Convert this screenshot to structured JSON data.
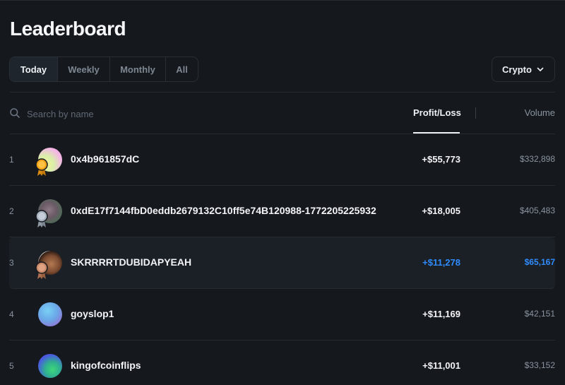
{
  "header": {
    "title": "Leaderboard"
  },
  "tabs": [
    {
      "label": "Today",
      "active": true
    },
    {
      "label": "Weekly",
      "active": false
    },
    {
      "label": "Monthly",
      "active": false
    },
    {
      "label": "All",
      "active": false
    }
  ],
  "category_select": {
    "value": "Crypto"
  },
  "search": {
    "placeholder": "Search by name",
    "value": ""
  },
  "columns": {
    "profit_loss": "Profit/Loss",
    "volume": "Volume"
  },
  "rows": [
    {
      "rank": "1",
      "name": "0x4b961857dC",
      "profit": "+$55,773",
      "volume": "$332,898",
      "medal": "gold"
    },
    {
      "rank": "2",
      "name": "0xdE17f7144fbD0eddb2679132C10ff5e74B120988-1772205225932",
      "profit": "+$18,005",
      "volume": "$405,483",
      "medal": "silver"
    },
    {
      "rank": "3",
      "name": "SKRRRRTDUBIDAPYEAH",
      "profit": "+$11,278",
      "volume": "$65,167",
      "medal": "bronze",
      "highlighted": true
    },
    {
      "rank": "4",
      "name": "goyslop1",
      "profit": "+$11,169",
      "volume": "$42,151"
    },
    {
      "rank": "5",
      "name": "kingofcoinflips",
      "profit": "+$11,001",
      "volume": "$33,152"
    }
  ],
  "colors": {
    "background": "#15191e",
    "highlight_blue": "#2f8cff",
    "gold": "#f2a51a",
    "silver": "#a8b3bf",
    "bronze": "#c98a6a"
  },
  "icons": [
    "search-icon",
    "chevron-down-icon",
    "gold-medal-icon",
    "silver-medal-icon",
    "bronze-medal-icon"
  ]
}
